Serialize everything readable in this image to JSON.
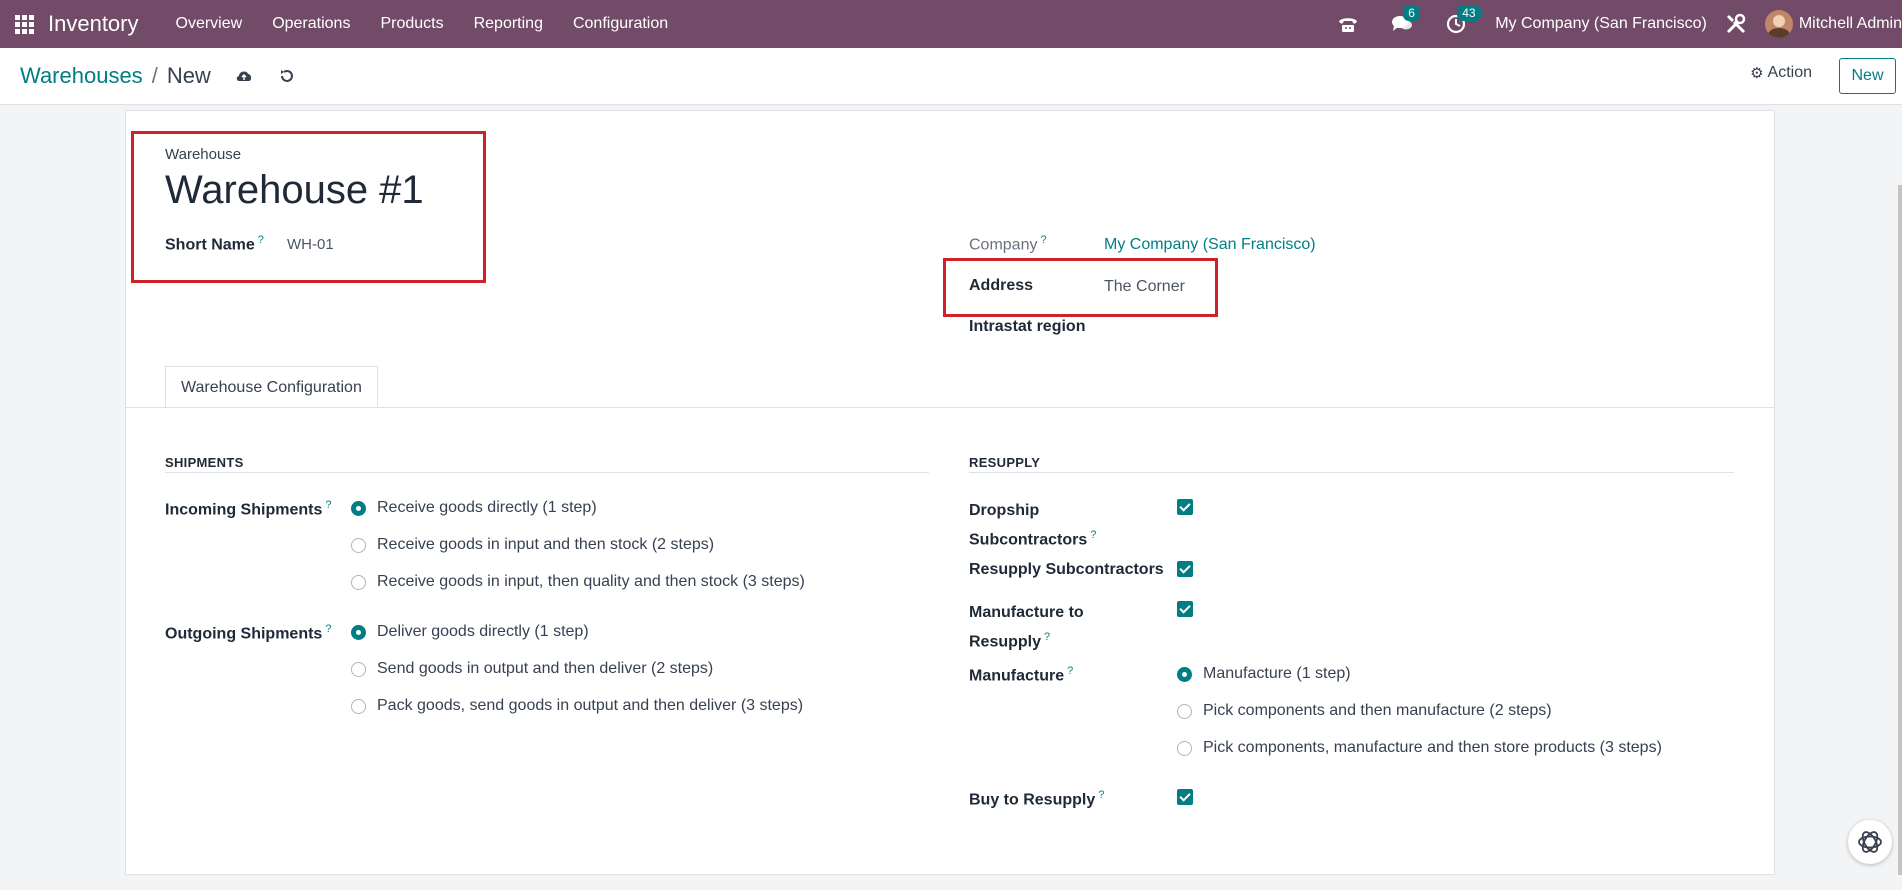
{
  "navbar": {
    "app_name": "Inventory",
    "menu": [
      "Overview",
      "Operations",
      "Products",
      "Reporting",
      "Configuration"
    ],
    "messages_count": "6",
    "activities_count": "43",
    "company": "My Company (San Francisco)",
    "user": "Mitchell Admin"
  },
  "breadcrumb": {
    "parent": "Warehouses",
    "separator": "/",
    "current": "New"
  },
  "control": {
    "action_label": "Action",
    "new_label": "New"
  },
  "form": {
    "warehouse_label": "Warehouse",
    "warehouse_name": "Warehouse #1",
    "short_name_label": "Short Name",
    "short_name_value": "WH-01",
    "company_label": "Company",
    "company_value": "My Company (San Francisco)",
    "address_label": "Address",
    "address_value": "The Corner",
    "intrastat_label": "Intrastat region",
    "help_mark": "?"
  },
  "tab": {
    "label": "Warehouse Configuration"
  },
  "shipments": {
    "title": "SHIPMENTS",
    "incoming_label": "Incoming Shipments",
    "incoming_options": [
      "Receive goods directly (1 step)",
      "Receive goods in input and then stock (2 steps)",
      "Receive goods in input, then quality and then stock (3 steps)"
    ],
    "incoming_selected": 0,
    "outgoing_label": "Outgoing Shipments",
    "outgoing_options": [
      "Deliver goods directly (1 step)",
      "Send goods in output and then deliver (2 steps)",
      "Pack goods, send goods in output and then deliver (3 steps)"
    ],
    "outgoing_selected": 0
  },
  "resupply": {
    "title": "RESUPPLY",
    "dropship_line1": "Dropship",
    "dropship_line2": "Subcontractors",
    "dropship_checked": true,
    "resupply_sub_label": "Resupply Subcontractors",
    "resupply_sub_checked": true,
    "mto_line1": "Manufacture to",
    "mto_line2": "Resupply",
    "mto_checked": true,
    "manufacture_label": "Manufacture",
    "manufacture_options": [
      "Manufacture (1 step)",
      "Pick components and then manufacture (2 steps)",
      "Pick components, manufacture and then store products (3 steps)"
    ],
    "manufacture_selected": 0,
    "buy_label": "Buy to Resupply",
    "buy_checked": true
  },
  "colors": {
    "navbar": "#714b67",
    "accent": "#017e84",
    "highlight": "#d0202a"
  }
}
